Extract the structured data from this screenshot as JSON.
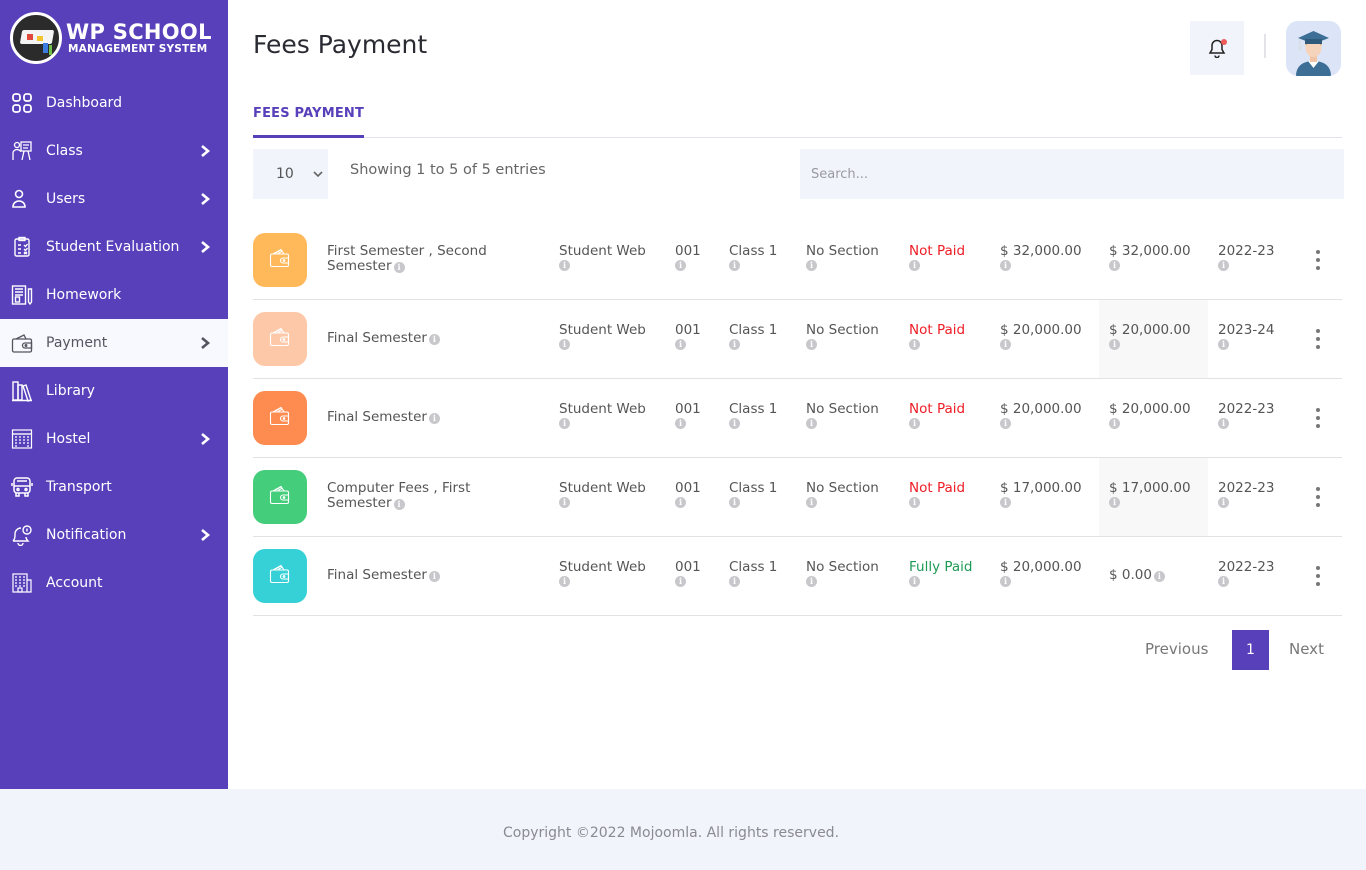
{
  "brand": {
    "title": "WP SCHOOL",
    "subtitle": "MANAGEMENT SYSTEM"
  },
  "sidebar": {
    "items": [
      {
        "label": "Dashboard",
        "icon": "dashboard-grid-icon",
        "has_submenu": false,
        "active": false
      },
      {
        "label": "Class",
        "icon": "class-teacher-icon",
        "has_submenu": true,
        "active": false
      },
      {
        "label": "Users",
        "icon": "user-icon",
        "has_submenu": true,
        "active": false
      },
      {
        "label": "Student Evaluation",
        "icon": "clipboard-icon",
        "has_submenu": true,
        "active": false
      },
      {
        "label": "Homework",
        "icon": "homework-icon",
        "has_submenu": false,
        "active": false
      },
      {
        "label": "Payment",
        "icon": "wallet-icon",
        "has_submenu": true,
        "active": true
      },
      {
        "label": "Library",
        "icon": "library-books-icon",
        "has_submenu": false,
        "active": false
      },
      {
        "label": "Hostel",
        "icon": "hostel-building-icon",
        "has_submenu": true,
        "active": false
      },
      {
        "label": "Transport",
        "icon": "bus-icon",
        "has_submenu": false,
        "active": false
      },
      {
        "label": "Notification",
        "icon": "notification-bell-icon",
        "has_submenu": true,
        "active": false
      },
      {
        "label": "Account",
        "icon": "account-building-icon",
        "has_submenu": false,
        "active": false
      }
    ]
  },
  "header": {
    "title": "Fees Payment",
    "bell_icon": "bell-icon",
    "has_notification_dot": true,
    "avatar_icon": "graduate-avatar-icon"
  },
  "tabs": [
    {
      "label": "FEES PAYMENT",
      "active": true
    }
  ],
  "table_controls": {
    "page_length": "10",
    "info": "Showing 1 to 5 of 5 entries",
    "search_placeholder": "Search...",
    "search_value": ""
  },
  "colors": {
    "brand": "#5840bb",
    "not_paid": "#ee1c25",
    "fully_paid": "#1e9a55"
  },
  "rows": [
    {
      "fee_type": "First Semester , Second Semester",
      "student": "Student Web",
      "roll": "001",
      "class": "Class 1",
      "section": "No Section",
      "status": "Not Paid",
      "status_kind": "not",
      "total": "$ 32,000.00",
      "due": "$ 32,000.00",
      "year": "2022-23",
      "tile_color": "#ffb95a",
      "due_highlight": false,
      "due_info_inline": false
    },
    {
      "fee_type": "Final Semester",
      "student": "Student Web",
      "roll": "001",
      "class": "Class 1",
      "section": "No Section",
      "status": "Not Paid",
      "status_kind": "not",
      "total": "$ 20,000.00",
      "due": "$ 20,000.00",
      "year": "2023-24",
      "tile_color": "#fdc8a8",
      "due_highlight": true,
      "due_info_inline": false
    },
    {
      "fee_type": "Final Semester",
      "student": "Student Web",
      "roll": "001",
      "class": "Class 1",
      "section": "No Section",
      "status": "Not Paid",
      "status_kind": "not",
      "total": "$ 20,000.00",
      "due": "$ 20,000.00",
      "year": "2022-23",
      "tile_color": "#fe8c50",
      "due_highlight": false,
      "due_info_inline": false
    },
    {
      "fee_type": "Computer Fees , First Semester",
      "student": "Student Web",
      "roll": "001",
      "class": "Class 1",
      "section": "No Section",
      "status": "Not Paid",
      "status_kind": "not",
      "total": "$ 17,000.00",
      "due": "$ 17,000.00",
      "year": "2022-23",
      "tile_color": "#44cd7b",
      "due_highlight": true,
      "due_info_inline": false
    },
    {
      "fee_type": "Final Semester",
      "student": "Student Web",
      "roll": "001",
      "class": "Class 1",
      "section": "No Section",
      "status": "Fully Paid",
      "status_kind": "full",
      "total": "$ 20,000.00",
      "due": "$ 0.00",
      "year": "2022-23",
      "tile_color": "#36d1d6",
      "due_highlight": false,
      "due_info_inline": true
    }
  ],
  "pagination": {
    "previous": "Previous",
    "current": "1",
    "next": "Next"
  },
  "footer": {
    "text": "Copyright ©2022 Mojoomla. All rights reserved."
  }
}
